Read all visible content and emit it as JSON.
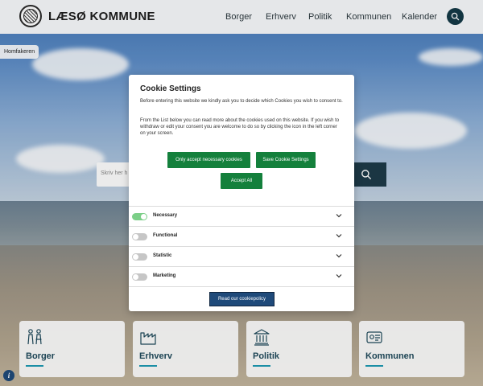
{
  "header": {
    "brand": "LÆSØ KOMMUNE",
    "nav": [
      "Borger",
      "Erhverv",
      "Politik",
      "Kommunen",
      "Kalender"
    ],
    "search_icon": "search-icon"
  },
  "genveje": {
    "label": "Homfakeren"
  },
  "hero_search": {
    "placeholder": "Skriv her h"
  },
  "cookie_modal": {
    "title": "Cookie Settings",
    "intro": "Before entering this website we kindly ask you to decide which Cookies you wish to consent to.",
    "detail": "From the List below you can read more about the cookies used on this website. If you wish to withdraw or edit your consent you are welcome to do so by clicking the icon in the left corner on your screen.",
    "btn_necessary": "Only accept necessary cookies",
    "btn_save": "Save Cookie Settings",
    "btn_accept": "Accept All",
    "categories": [
      {
        "label": "Necessary",
        "on": true
      },
      {
        "label": "Functional",
        "on": false
      },
      {
        "label": "Statistic",
        "on": false
      },
      {
        "label": "Marketing",
        "on": false
      }
    ],
    "btn_policy": "Read our cookiepolicy"
  },
  "cards": [
    {
      "label": "Borger",
      "icon": "people-icon"
    },
    {
      "label": "Erhverv",
      "icon": "factory-icon"
    },
    {
      "label": "Politik",
      "icon": "townhall-icon"
    },
    {
      "label": "Kommunen",
      "icon": "id-card-icon"
    }
  ],
  "colors": {
    "accent_green": "#14803c",
    "brand_navy": "#1f4a7a",
    "card_text": "#1f4a5c",
    "card_underline": "#1e9bb4",
    "toggle_on": "#7ccf88"
  }
}
